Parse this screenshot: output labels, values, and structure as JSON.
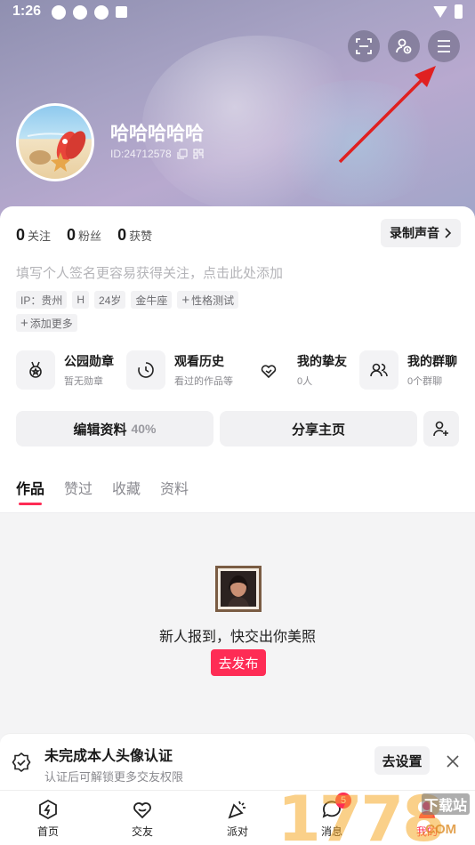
{
  "status_bar": {
    "time": "1:26"
  },
  "profile": {
    "nickname": "哈哈哈哈哈",
    "user_id": "ID:24712578"
  },
  "stats": [
    {
      "num": "0",
      "label": "关注"
    },
    {
      "num": "0",
      "label": "粉丝"
    },
    {
      "num": "0",
      "label": "获赞"
    }
  ],
  "record_button": "录制声音",
  "bio_placeholder": "填写个人签名更容易获得关注，点击此处添加",
  "tags": [
    "IP：贵州",
    "H",
    "24岁",
    "金牛座",
    "性格测试"
  ],
  "tag_add": "添加更多",
  "features": [
    {
      "title": "公园勋章",
      "sub": "暂无勋章",
      "icon": "medal-icon"
    },
    {
      "title": "观看历史",
      "sub": "看过的作品等",
      "icon": "clock-icon"
    },
    {
      "title": "我的挚友",
      "sub": "0人",
      "icon": "heart-friends-icon"
    },
    {
      "title": "我的群聊",
      "sub": "0个群聊",
      "icon": "group-icon"
    }
  ],
  "actions": {
    "edit_label": "编辑资料",
    "edit_percent": "40%",
    "share_label": "分享主页"
  },
  "tabs": [
    "作品",
    "赞过",
    "收藏",
    "资料"
  ],
  "empty_state": {
    "text": "新人报到，快交出你美照",
    "button": "去发布"
  },
  "notice": {
    "title": "未完成本人头像认证",
    "subtitle": "认证后可解锁更多交友权限",
    "button": "去设置"
  },
  "bottom_nav": [
    {
      "label": "首页",
      "icon": "home-icon"
    },
    {
      "label": "交友",
      "icon": "heart-icon"
    },
    {
      "label": "派对",
      "icon": "party-icon"
    },
    {
      "label": "消息",
      "icon": "message-icon",
      "badge": "5"
    },
    {
      "label": "我的",
      "icon": "profile-icon"
    }
  ],
  "watermark": {
    "digits": "1778",
    "site": "下载站",
    "com": ".COM"
  },
  "colors": {
    "accent": "#fe2c55",
    "header": "#a7a2c4",
    "arrow": "#e02020"
  }
}
